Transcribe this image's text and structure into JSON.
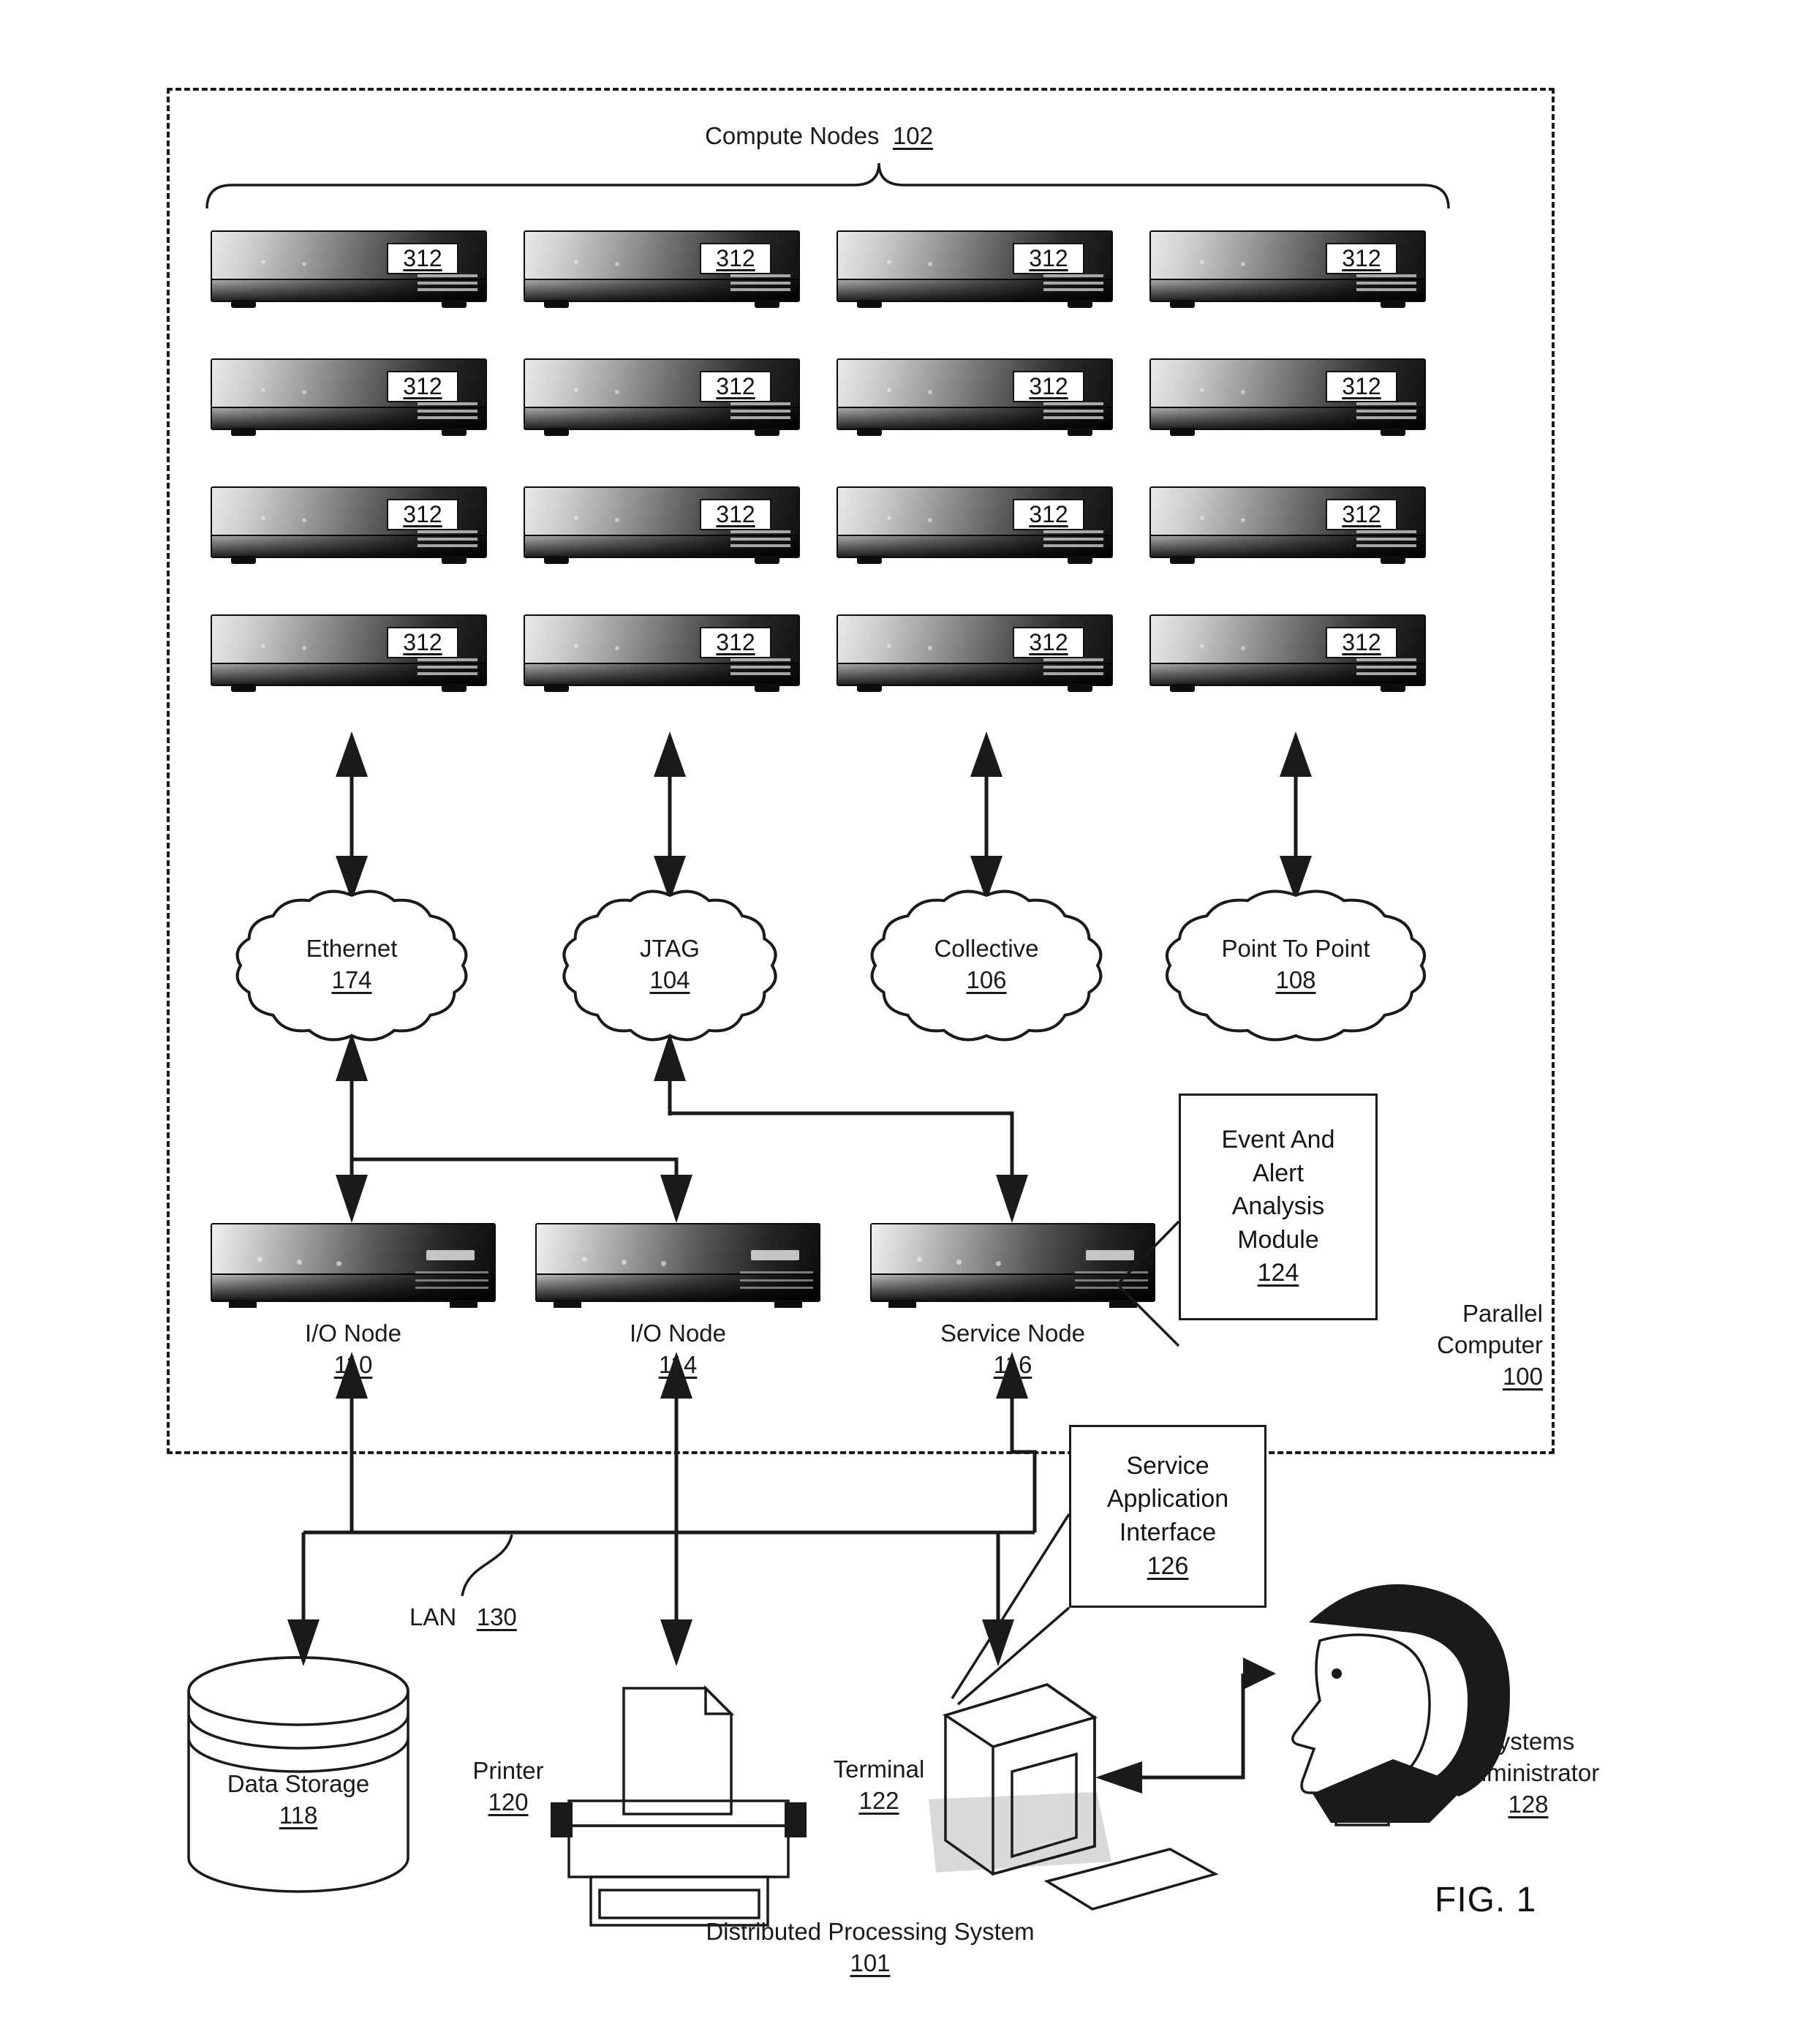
{
  "figure": {
    "caption": "FIG. 1",
    "bottom_title": "Distributed Processing System",
    "bottom_title_ref": "101"
  },
  "compute_nodes": {
    "title": "Compute Nodes",
    "ref": "102",
    "node_label": "312",
    "rows": 4,
    "cols": 4,
    "labels": [
      [
        "312",
        "312",
        "312",
        "312"
      ],
      [
        "312",
        "312",
        "312",
        "312"
      ],
      [
        "312",
        "312",
        "312",
        "312"
      ],
      [
        "312",
        "312",
        "312",
        "312"
      ]
    ]
  },
  "networks": [
    {
      "name": "Ethernet",
      "ref": "174"
    },
    {
      "name": "JTAG",
      "ref": "104"
    },
    {
      "name": "Collective",
      "ref": "106"
    },
    {
      "name": "Point To Point",
      "ref": "108"
    }
  ],
  "nodes": [
    {
      "name": "I/O Node",
      "ref": "110"
    },
    {
      "name": "I/O Node",
      "ref": "114"
    },
    {
      "name": "Service Node",
      "ref": "116"
    }
  ],
  "modules": {
    "event_alert": {
      "lines": [
        "Event And",
        "Alert",
        "Analysis",
        "Module"
      ],
      "ref": "124"
    },
    "service_app": {
      "lines": [
        "Service",
        "Application",
        "Interface"
      ],
      "ref": "126"
    }
  },
  "parallel_computer": {
    "lines": [
      "Parallel",
      "Computer"
    ],
    "ref": "100"
  },
  "lan": {
    "name": "LAN",
    "ref": "130"
  },
  "peripherals": [
    {
      "name": "Data Storage",
      "ref": "118"
    },
    {
      "name": "Printer",
      "ref": "120"
    },
    {
      "name": "Terminal",
      "ref": "122"
    }
  ],
  "actor": {
    "lines": [
      "Systems",
      "Administrator"
    ],
    "ref": "128"
  }
}
